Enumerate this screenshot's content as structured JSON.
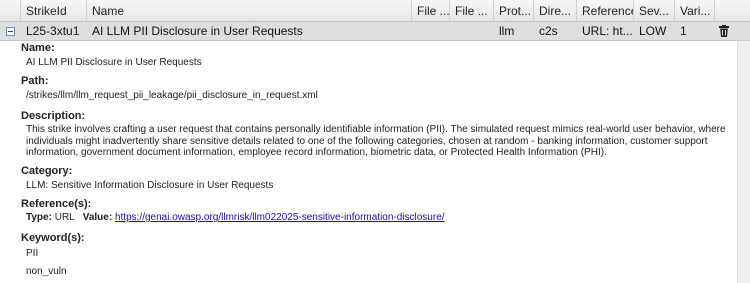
{
  "columns": [
    "StrikeId",
    "Name",
    "File ...",
    "File ...",
    "Prot...",
    "Dire...",
    "Reference",
    "Sev...",
    "Vari..."
  ],
  "row": {
    "strike_id": "L25-3xtu1",
    "name": "AI LLM PII Disclosure in User Requests",
    "file1": "",
    "file2": "",
    "protocol": "llm",
    "direction": "c2s",
    "reference": "URL: ht...",
    "severity": "LOW",
    "variants": "1"
  },
  "detail": {
    "name_label": "Name:",
    "name_value": "AI LLM PII Disclosure in User Requests",
    "path_label": "Path:",
    "path_value": "/strikes/llm/llm_request_pii_leakage/pii_disclosure_in_request.xml",
    "description_label": "Description:",
    "description_value": "This strike involves crafting a user request that contains personally identifiable information (PII). The simulated request mimics real-world user behavior, where individuals might inadvertently share sensitive details related to one of the following categories, chosen at random - banking information, customer support information, government document information, employee record information, biometric data, or Protected Health Information (PHI).",
    "category_label": "Category:",
    "category_value": "LLM: Sensitive Information Disclosure in User Requests",
    "references_label": "Reference(s):",
    "reference_type_label": "Type:",
    "reference_type_value": "URL",
    "reference_value_label": "Value:",
    "reference_url": "https://genai.owasp.org/llmrisk/llm022025-sensitive-information-disclosure/",
    "keywords_label": "Keyword(s):",
    "keywords": [
      "PII",
      "non_vuln"
    ]
  }
}
